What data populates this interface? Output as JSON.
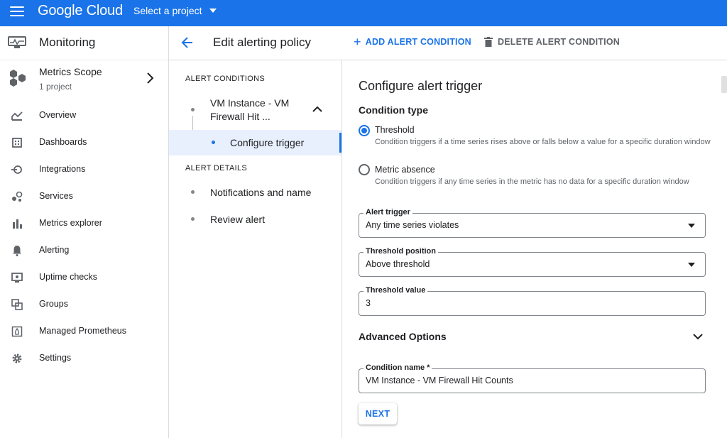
{
  "topbar": {
    "brand": "Google Cloud",
    "project_select": "Select a project"
  },
  "leftnav": {
    "title": "Monitoring",
    "scope_title": "Metrics Scope",
    "scope_sub": "1 project",
    "items": [
      {
        "label": "Overview",
        "icon": "overview-icon"
      },
      {
        "label": "Dashboards",
        "icon": "dashboards-icon"
      },
      {
        "label": "Integrations",
        "icon": "integrations-icon"
      },
      {
        "label": "Services",
        "icon": "services-icon"
      },
      {
        "label": "Metrics explorer",
        "icon": "bar-chart-icon"
      },
      {
        "label": "Alerting",
        "icon": "bell-icon"
      },
      {
        "label": "Uptime checks",
        "icon": "monitor-icon"
      },
      {
        "label": "Groups",
        "icon": "groups-icon"
      },
      {
        "label": "Managed Prometheus",
        "icon": "prometheus-icon"
      },
      {
        "label": "Settings",
        "icon": "gear-icon"
      }
    ]
  },
  "header": {
    "title": "Edit alerting policy",
    "add_condition": "ADD ALERT CONDITION",
    "delete_condition": "DELETE ALERT CONDITION"
  },
  "steps": {
    "conditions_heading": "ALERT CONDITIONS",
    "condition_line1": "VM Instance - VM",
    "condition_line2": "Firewall Hit ...",
    "configure_trigger": "Configure trigger",
    "details_heading": "ALERT DETAILS",
    "notifications": "Notifications and name",
    "review": "Review alert"
  },
  "form": {
    "title": "Configure alert trigger",
    "condition_type_heading": "Condition type",
    "threshold_label": "Threshold",
    "threshold_desc": "Condition triggers if a time series rises above or falls below a value for a specific duration window",
    "absence_label": "Metric absence",
    "absence_desc": "Condition triggers if any time series in the metric has no data for a specific duration window",
    "selected_type": "Threshold",
    "alert_trigger_label": "Alert trigger",
    "alert_trigger_value": "Any time series violates",
    "threshold_position_label": "Threshold position",
    "threshold_position_value": "Above threshold",
    "threshold_value_label": "Threshold value",
    "threshold_value": "3",
    "advanced_options": "Advanced Options",
    "condition_name_label": "Condition name *",
    "condition_name_value": "VM Instance - VM Firewall Hit Counts",
    "next_button": "NEXT"
  },
  "colors": {
    "brand_blue": "#1a73e8",
    "active_bg": "#e8f0fe"
  }
}
